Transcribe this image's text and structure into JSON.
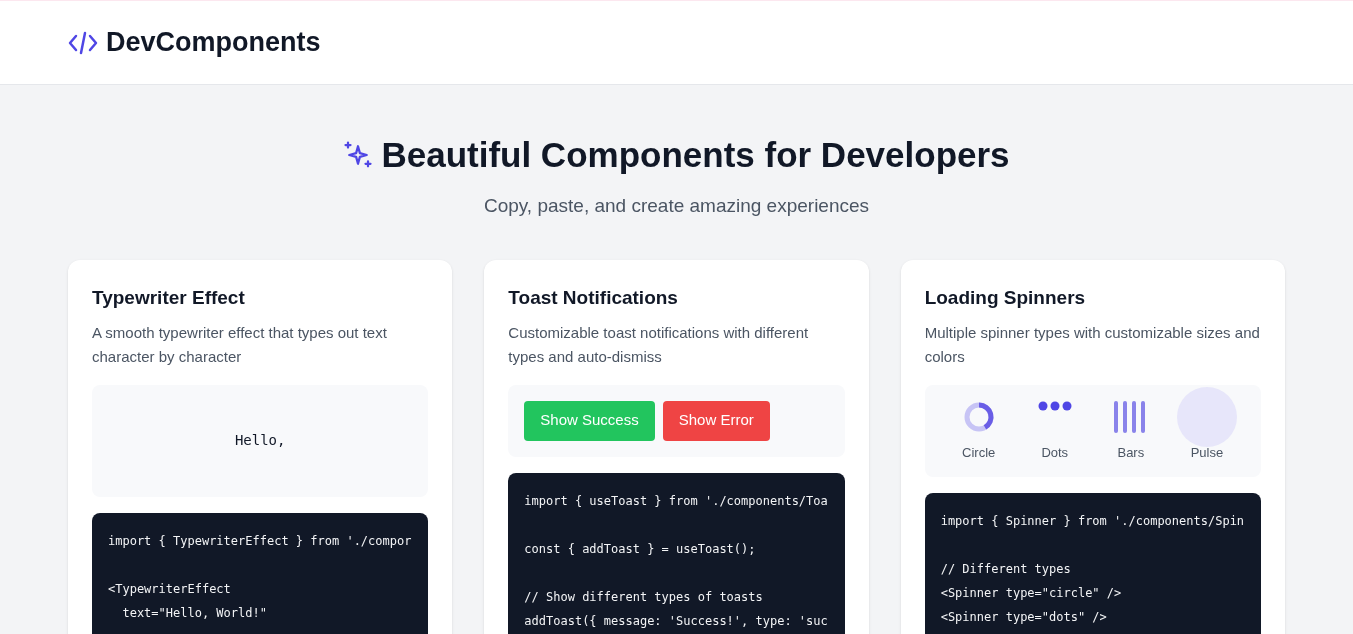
{
  "header": {
    "logo_text": "DevComponents"
  },
  "hero": {
    "title": "Beautiful Components for Developers",
    "subtitle": "Copy, paste, and create amazing experiences"
  },
  "cards": [
    {
      "title": "Typewriter Effect",
      "description": "A smooth typewriter effect that types out text character by character",
      "preview": {
        "kind": "typewriter",
        "text": "Hello,"
      },
      "code_blocks": [
        [
          "import { TypewriterEffect } from './compor"
        ],
        [
          "<TypewriterEffect",
          "  text=\"Hello, World!\""
        ]
      ]
    },
    {
      "title": "Toast Notifications",
      "description": "Customizable toast notifications with different types and auto-dismiss",
      "preview": {
        "kind": "buttons",
        "buttons": [
          {
            "label": "Show Success",
            "color": "#22c55e"
          },
          {
            "label": "Show Error",
            "color": "#ef4444"
          }
        ]
      },
      "code_blocks": [
        [
          "import { useToast } from './components/Toa"
        ],
        [
          "const { addToast } = useToast();"
        ],
        [
          "// Show different types of toasts",
          "addToast({ message: 'Success!', type: 'suc"
        ]
      ]
    },
    {
      "title": "Loading Spinners",
      "description": "Multiple spinner types with customizable sizes and colors",
      "preview": {
        "kind": "spinners",
        "spinners": [
          {
            "kind": "circle",
            "label": "Circle"
          },
          {
            "kind": "dots",
            "label": "Dots"
          },
          {
            "kind": "bars",
            "label": "Bars"
          },
          {
            "kind": "pulse",
            "label": "Pulse"
          }
        ]
      },
      "code_blocks": [
        [
          "import { Spinner } from './components/Spin"
        ],
        [
          "// Different types",
          "<Spinner type=\"circle\" />",
          "<Spinner type=\"dots\" />"
        ]
      ]
    }
  ]
}
